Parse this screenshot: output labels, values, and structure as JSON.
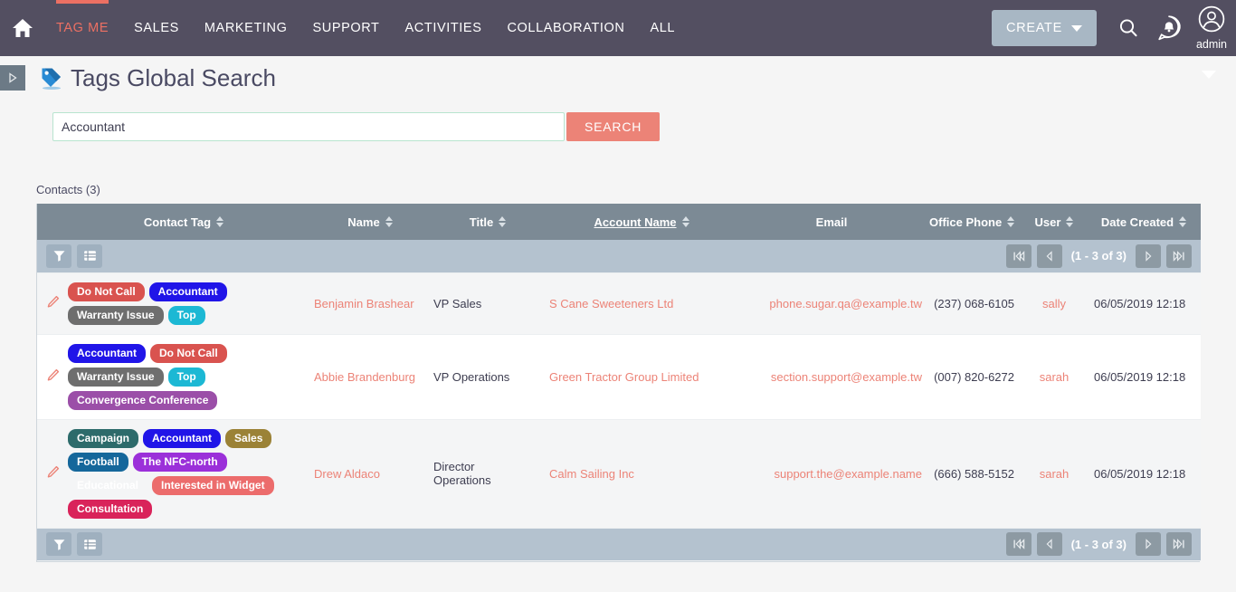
{
  "nav": {
    "home_icon": "home-icon",
    "items": [
      {
        "label": "TAG ME",
        "active": true
      },
      {
        "label": "SALES",
        "active": false
      },
      {
        "label": "MARKETING",
        "active": false
      },
      {
        "label": "SUPPORT",
        "active": false
      },
      {
        "label": "ACTIVITIES",
        "active": false
      },
      {
        "label": "COLLABORATION",
        "active": false
      },
      {
        "label": "ALL",
        "active": false
      }
    ],
    "create_label": "CREATE",
    "search_icon": "search-icon",
    "notifications_icon": "notification-bell-icon",
    "profile_icon": "user-avatar-icon",
    "profile_label": "admin"
  },
  "page": {
    "title": "Tags Global Search",
    "module_icon": "tag-icon",
    "sidebar_toggle_icon": "expand-sidebar-icon",
    "panel_collapse_icon": "chevron-down-icon"
  },
  "search": {
    "value": "Accountant",
    "placeholder": "",
    "button_label": "SEARCH"
  },
  "results": {
    "label": "Contacts (3)",
    "columns": [
      {
        "key": "tag",
        "label": "Contact Tag",
        "sortable": true,
        "sorted": false
      },
      {
        "key": "name",
        "label": "Name",
        "sortable": true,
        "sorted": false
      },
      {
        "key": "title",
        "label": "Title",
        "sortable": true,
        "sorted": false
      },
      {
        "key": "account",
        "label": "Account Name",
        "sortable": true,
        "sorted": true
      },
      {
        "key": "email",
        "label": "Email",
        "sortable": false,
        "sorted": false
      },
      {
        "key": "phone",
        "label": "Office Phone",
        "sortable": true,
        "sorted": false
      },
      {
        "key": "user",
        "label": "User",
        "sortable": true,
        "sorted": false
      },
      {
        "key": "date",
        "label": "Date Created",
        "sortable": true,
        "sorted": false
      }
    ],
    "toolbar": {
      "filter_icon": "funnel-filter-icon",
      "columns_icon": "column-chooser-icon"
    },
    "pager": {
      "first_icon": "first-page-icon",
      "prev_icon": "previous-page-icon",
      "next_icon": "next-page-icon",
      "last_icon": "last-page-icon",
      "count_label": "(1 - 3 of 3)"
    },
    "rows": [
      {
        "edit_icon": "edit-pencil-icon",
        "tags": [
          {
            "label": "Do Not Call",
            "color": "#d9534f"
          },
          {
            "label": "Accountant",
            "color": "#2015e8"
          },
          {
            "label": "Warranty Issue",
            "color": "#6e6e6e"
          },
          {
            "label": "Top",
            "color": "#1cb8d4"
          }
        ],
        "name": "Benjamin Brashear",
        "title": "VP Sales",
        "account": "S Cane Sweeteners Ltd",
        "email": "phone.sugar.qa@example.tw",
        "phone": "(237) 068-6105",
        "user": "sally",
        "date": "06/05/2019 12:18"
      },
      {
        "edit_icon": "edit-pencil-icon",
        "tags": [
          {
            "label": "Accountant",
            "color": "#2015e8"
          },
          {
            "label": "Do Not Call",
            "color": "#d9534f"
          },
          {
            "label": "Warranty Issue",
            "color": "#6e6e6e"
          },
          {
            "label": "Top",
            "color": "#1cb8d4"
          },
          {
            "label": "Convergence Conference",
            "color": "#9b4fa8"
          }
        ],
        "name": "Abbie Brandenburg",
        "title": "VP Operations",
        "account": "Green Tractor Group Limited",
        "email": "section.support@example.tw",
        "phone": "(007) 820-6272",
        "user": "sarah",
        "date": "06/05/2019 12:18"
      },
      {
        "edit_icon": "edit-pencil-icon",
        "tags": [
          {
            "label": "Campaign",
            "color": "#2d6b6b"
          },
          {
            "label": "Accountant",
            "color": "#2015e8"
          },
          {
            "label": "Sales",
            "color": "#9b8236"
          },
          {
            "label": "Football",
            "color": "#15679b"
          },
          {
            "label": "The NFC-north",
            "color": "#9b30d9"
          },
          {
            "label": "Educational",
            "color": "#eeb košt"
          },
          {
            "label": "Interested in Widget",
            "color": "#ec6c6c"
          },
          {
            "label": "Consultation",
            "color": "#d9235a"
          }
        ],
        "name": "Drew Aldaco",
        "title": "Director Operations",
        "account": "Calm Sailing Inc",
        "email": "support.the@example.name",
        "phone": "(666) 588-5152",
        "user": "sarah",
        "date": "06/05/2019 12:18"
      }
    ]
  },
  "colors": {
    "nav_bg": "#534f61",
    "accent": "#ec8377",
    "header_bg": "#7c8a95",
    "toolbar_bg": "#b4c2cf"
  }
}
